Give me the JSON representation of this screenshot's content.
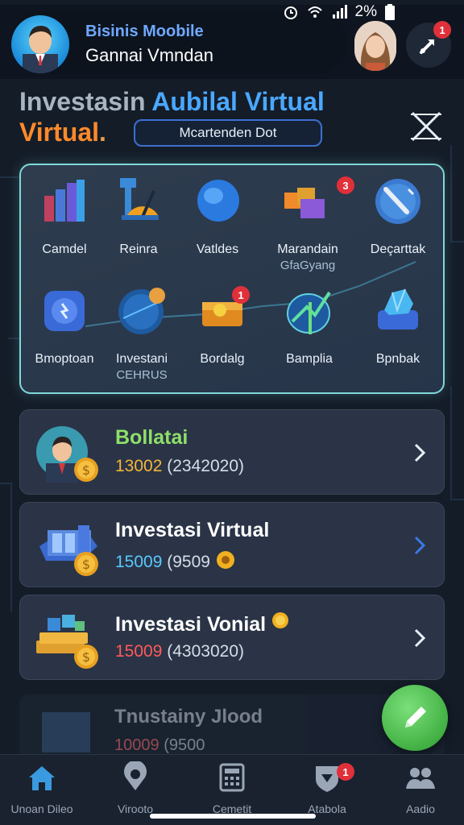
{
  "status_bar": {
    "battery_percent": "2%"
  },
  "header": {
    "title": "Bisinis Moobile",
    "subtitle": "Gannai Vmndan"
  },
  "notifications": {
    "badge_count": "1"
  },
  "page": {
    "title_part1": "Investasin ",
    "title_part2": "Aubilal Virtual",
    "title_line2": "Virtual",
    "title_dot": ".",
    "search_label": "Mcartenden Dot"
  },
  "grid": {
    "items": [
      {
        "label": "Camdel",
        "label2": "",
        "icon": "bar-chart-icon"
      },
      {
        "label": "Reinra",
        "label2": "",
        "icon": "gauge-icon"
      },
      {
        "label": "Vatldes",
        "label2": "",
        "icon": "blue-orb-icon"
      },
      {
        "label": "Marandain",
        "label2": "GfaGyang",
        "icon": "cubes-icon",
        "badge": "3"
      },
      {
        "label": "Deçarttak",
        "label2": "",
        "icon": "pen-circle-icon"
      },
      {
        "label": "Bmoptoan",
        "label2": "",
        "icon": "gear-icon"
      },
      {
        "label": "Investani",
        "label2": "CEHRUS",
        "icon": "globe-icon"
      },
      {
        "label": "Bordalg",
        "label2": "",
        "icon": "coin-box-icon",
        "badge": "1"
      },
      {
        "label": "Bamplia",
        "label2": "",
        "icon": "growth-sphere-icon"
      },
      {
        "label": "Bpnbak",
        "label2": "",
        "icon": "crystal-icon"
      }
    ]
  },
  "list": [
    {
      "title": "Bollatai",
      "value": "13002",
      "paren": "(2342020)",
      "title_color": "#8fe06a",
      "value_color": "#f5b53a",
      "icon": "businessman-avatar-icon"
    },
    {
      "title": "Investasi Virtual",
      "value": "15009",
      "paren": "(9509",
      "title_color": "#ffffff",
      "value_color": "#5bc8ff",
      "icon": "server-coin-icon"
    },
    {
      "title": "Investasi Vonial",
      "value": "15009",
      "paren": "(4303020)",
      "title_color": "#ffffff",
      "value_color": "#ff5a5a",
      "icon": "cash-stack-icon"
    }
  ],
  "faded_item": {
    "title": "Tnustainy Jlood",
    "value": "10009",
    "paren": "(9500"
  },
  "bottom_nav": [
    {
      "label": "Unoan Dileo",
      "icon": "home-icon",
      "active": true
    },
    {
      "label": "Virooto",
      "icon": "location-icon"
    },
    {
      "label": "Cemetit",
      "icon": "calculator-icon"
    },
    {
      "label": "Atabola",
      "icon": "shield-icon",
      "badge": "1"
    },
    {
      "label": "Aadio",
      "icon": "users-icon"
    }
  ],
  "colors": {
    "accent": "#4aa8ff",
    "fab": "#3aaa3c",
    "badge": "#e0303a"
  }
}
